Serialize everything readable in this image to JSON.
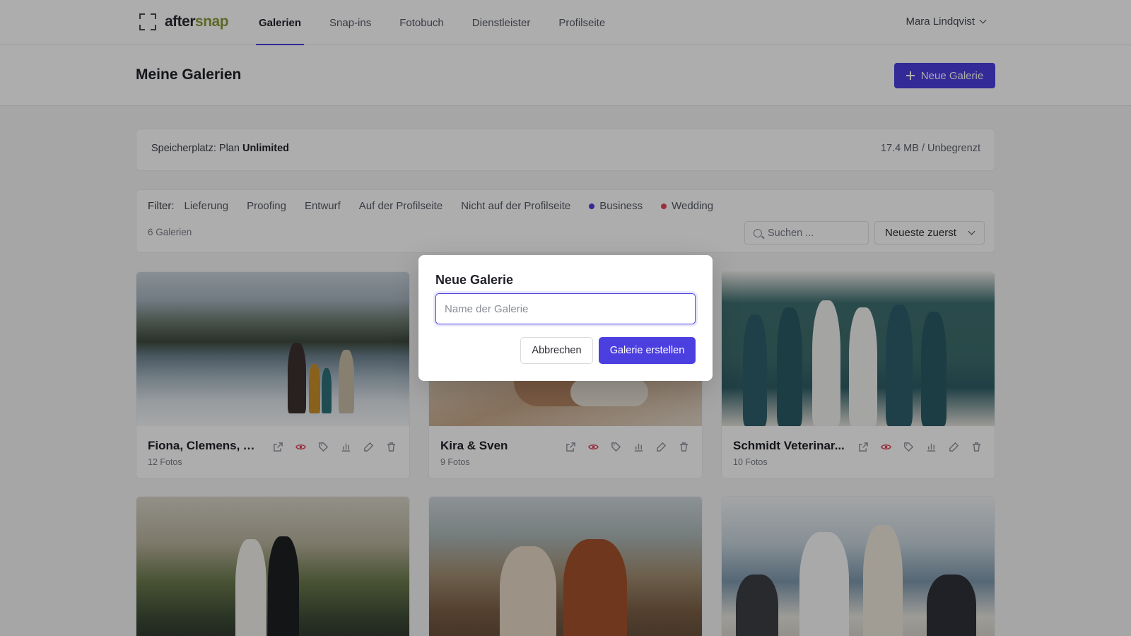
{
  "brand": {
    "name_part1": "after",
    "name_part2": "snap"
  },
  "nav": {
    "tabs": [
      {
        "label": "Galerien",
        "active": true
      },
      {
        "label": "Snap-ins",
        "active": false
      },
      {
        "label": "Fotobuch",
        "active": false
      },
      {
        "label": "Dienstleister",
        "active": false
      },
      {
        "label": "Profilseite",
        "active": false
      }
    ],
    "user_name": "Mara Lindqvist"
  },
  "header": {
    "title": "Meine Galerien",
    "new_button_label": "Neue Galerie"
  },
  "storage": {
    "label_prefix": "Speicherplatz: Plan ",
    "plan": "Unlimited",
    "usage": "17.4 MB / Unbegrenzt"
  },
  "filters": {
    "label": "Filter:",
    "items": [
      {
        "label": "Lieferung"
      },
      {
        "label": "Proofing"
      },
      {
        "label": "Entwurf"
      },
      {
        "label": "Auf der Profilseite"
      },
      {
        "label": "Nicht auf der Profilseite"
      },
      {
        "label": "Business",
        "dot_color": "#4c3fe0"
      },
      {
        "label": "Wedding",
        "dot_color": "#e2455a"
      }
    ],
    "count": "6 Galerien",
    "search_placeholder": "Suchen ...",
    "sort_value": "Neueste zuerst"
  },
  "galleries": [
    {
      "title": "Fiona, Clemens, A...",
      "count": "12 Fotos"
    },
    {
      "title": "Kira & Sven",
      "count": "9 Fotos"
    },
    {
      "title": "Schmidt Veterinar...",
      "count": "10 Fotos"
    },
    {
      "title": "",
      "count": ""
    },
    {
      "title": "",
      "count": ""
    },
    {
      "title": "",
      "count": ""
    }
  ],
  "icons": {
    "actions": [
      "external-link-icon",
      "eye-icon",
      "tag-icon",
      "bar-chart-icon",
      "edit-icon",
      "trash-icon"
    ],
    "eye_color": "#e2455a"
  },
  "modal": {
    "title": "Neue Galerie",
    "input_placeholder": "Name der Galerie",
    "input_value": "",
    "cancel_label": "Abbrechen",
    "create_label": "Galerie erstellen"
  }
}
